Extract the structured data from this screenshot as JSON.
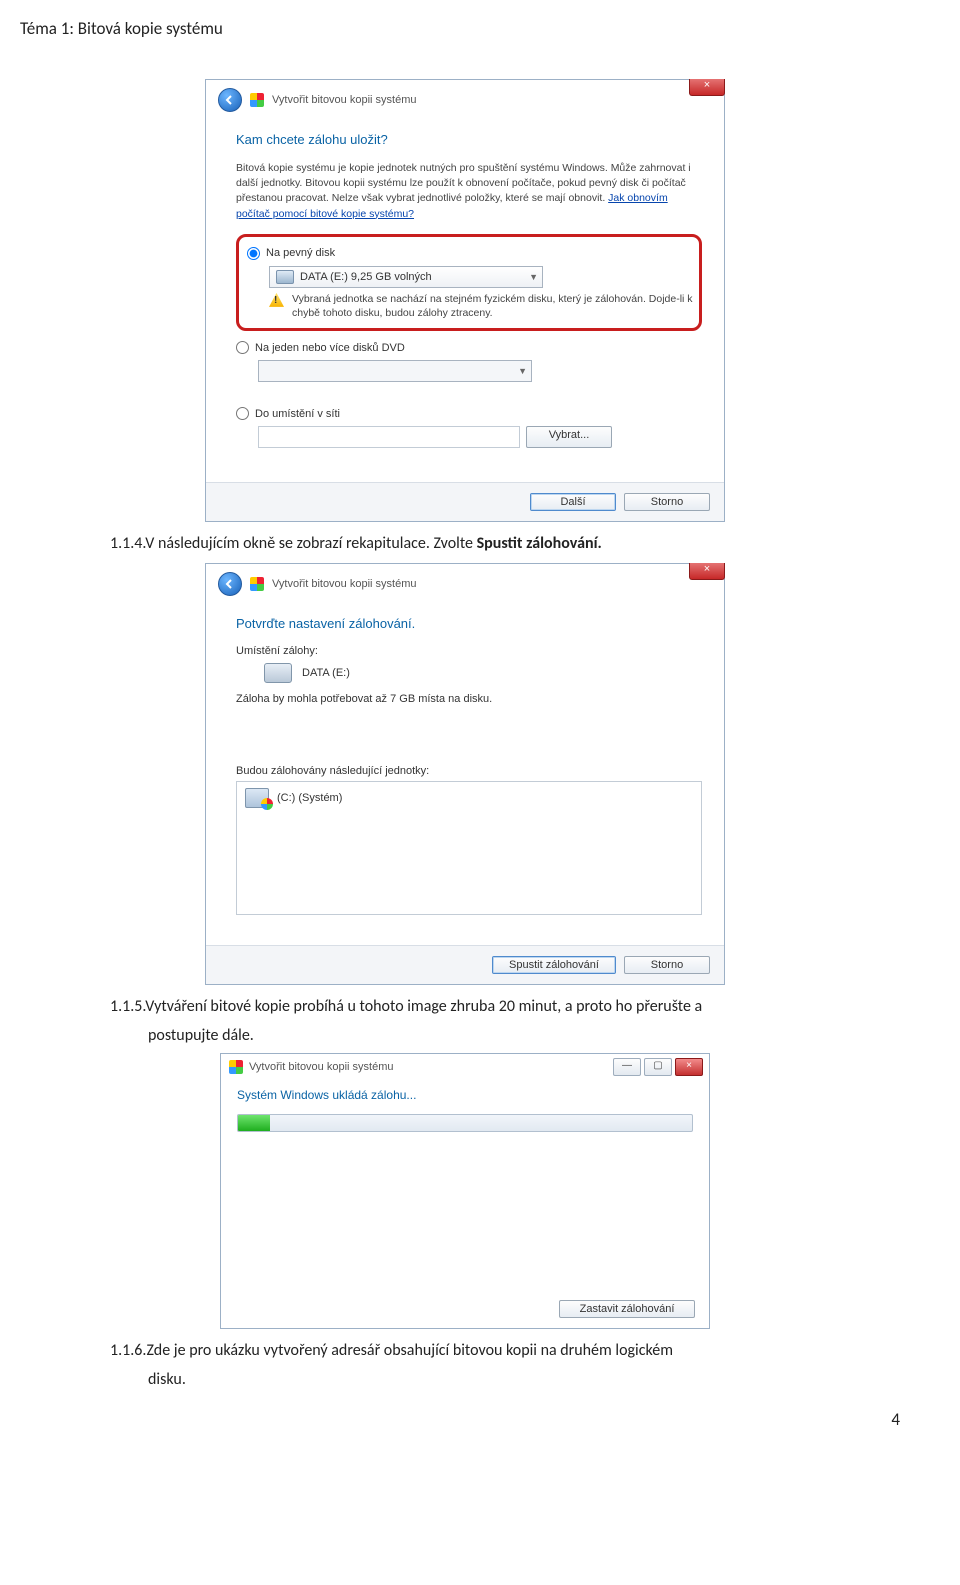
{
  "doc": {
    "heading": "Téma 1: Bitová kopie systému",
    "step4_pre": "1.1.4.V následujícím okně se zobrazí rekapitulace. Zvolte ",
    "step4_bold": "Spustit zálohování.",
    "step5": "1.1.5.Vytváření bitové kopie probíhá u tohoto image zhruba 20 minut, a proto ho přerušte a",
    "step5b": "postupujte dále.",
    "step6": "1.1.6.Zde je pro ukázku vytvořený adresář obsahující bitovou kopii na druhém logickém",
    "step6b": "disku.",
    "page_number": "4"
  },
  "win1": {
    "title": "Vytvořit bitovou kopii systému",
    "heading": "Kam chcete zálohu uložit?",
    "info": "Bitová kopie systému je kopie jednotek nutných pro spuštění systému Windows. Může zahrnovat i další jednotky. Bitovou kopii systému lze použít k obnovení počítače, pokud pevný disk či počítač přestanou pracovat. Nelze však vybrat jednotlivé položky, které se mají obnovit. ",
    "info_link": "Jak obnovím počítač pomocí bitové kopie systému?",
    "opt_hdd": "Na pevný disk",
    "drive_label": "DATA (E:)  9,25 GB volných",
    "warn": "Vybraná jednotka se nachází na stejném fyzickém disku, který je zálohován. Dojde-li k chybě tohoto disku, budou zálohy ztraceny.",
    "opt_dvd": "Na jeden nebo více disků DVD",
    "opt_net": "Do umístění v síti",
    "browse": "Vybrat...",
    "next": "Další",
    "cancel": "Storno"
  },
  "win2": {
    "title": "Vytvořit bitovou kopii systému",
    "heading": "Potvrďte nastavení zálohování.",
    "loc_label": "Umístění zálohy:",
    "loc_value": "DATA (E:)",
    "space": "Záloha by mohla potřebovat až 7 GB místa na disku.",
    "units_label": "Budou zálohovány následující jednotky:",
    "unit_c": "(C:) (Systém)",
    "start": "Spustit zálohování",
    "cancel": "Storno"
  },
  "win3": {
    "title": "Vytvořit bitovou kopii systému",
    "status": "Systém Windows ukládá zálohu...",
    "stop": "Zastavit zálohování"
  }
}
